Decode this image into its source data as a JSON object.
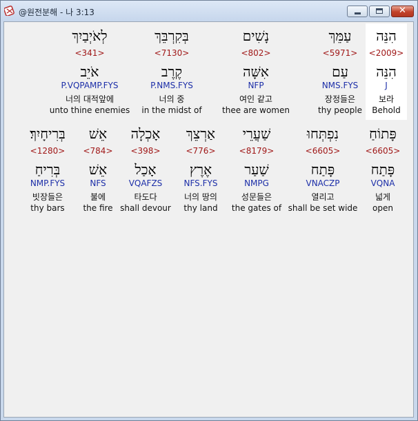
{
  "window": {
    "title": "@원전분해 - 나 3:13",
    "minimize_label": "",
    "maximize_label": "",
    "close_label": "✕"
  },
  "rows": [
    {
      "cells": [
        {
          "word": "הִנֵּה",
          "strong": "<2009>",
          "lemma": "הִנֵּה",
          "morph": "J",
          "korean": "보라",
          "english": "Behold",
          "highlight": true
        },
        {
          "word": "עַמֵּךְ",
          "strong": "<5971>",
          "lemma": "עַם",
          "morph": "NMS.FYS",
          "korean": "장정들은",
          "english": "thy people",
          "highlight": false
        },
        {
          "word": "נָשִׁים",
          "strong": "<802>",
          "lemma": "אִשָּׁה",
          "morph": "NFP",
          "korean": "여인 같고",
          "english": "thee are women",
          "highlight": false
        },
        {
          "word": "בְּקִרְבֵּךְ",
          "strong": "<7130>",
          "lemma": "קֶרֶב",
          "morph": "P.NMS.FYS",
          "korean": "너의 중",
          "english": "in the midst of",
          "highlight": false
        },
        {
          "word": "לְאֹיְבַיִךְ",
          "strong": "<341>",
          "lemma": "אֹיֵב",
          "morph": "P.VQPAMP.FYS",
          "korean": "너의 대적앞에",
          "english": "unto thine enemies",
          "highlight": false
        }
      ]
    },
    {
      "cells": [
        {
          "word": "פָּתוֹחַ",
          "strong": "<6605>",
          "lemma": "פָּתַח",
          "morph": "VQNA",
          "korean": "넓게",
          "english": "open",
          "highlight": false
        },
        {
          "word": "נִפְתְּחוּ",
          "strong": "<6605>",
          "lemma": "פָּתַח",
          "morph": "VNACZP",
          "korean": "열리고",
          "english": "shall be set wide",
          "highlight": false
        },
        {
          "word": "שַׁעֲרֵי",
          "strong": "<8179>",
          "lemma": "שַׁעַר",
          "morph": "NMPG",
          "korean": "성문들은",
          "english": "the gates of",
          "highlight": false
        },
        {
          "word": "אַרְצֵךְ",
          "strong": "<776>",
          "lemma": "אֶרֶץ",
          "morph": "NFS.FYS",
          "korean": "너의 땅의",
          "english": "thy land",
          "highlight": false
        },
        {
          "word": "אָכְלָה",
          "strong": "<398>",
          "lemma": "אָכַל",
          "morph": "VQAFZS",
          "korean": "타도다",
          "english": "shall devour",
          "highlight": false
        },
        {
          "word": "אֵשׁ",
          "strong": "<784>",
          "lemma": "אֵשׁ",
          "morph": "NFS",
          "korean": "불에",
          "english": "the fire",
          "highlight": false
        },
        {
          "word": "בְּרִיחָיִךְ׃",
          "strong": "<1280>",
          "lemma": "בְּרִיחַ",
          "morph": "NMP.FYS",
          "korean": "빗장들은",
          "english": "thy bars",
          "highlight": false
        }
      ]
    }
  ]
}
